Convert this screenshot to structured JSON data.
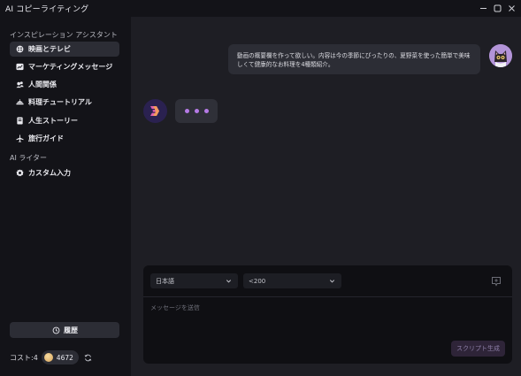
{
  "window": {
    "title": "AI コピーライティング",
    "controls": {
      "minimize": "—",
      "maximize": "□",
      "close": "✕"
    }
  },
  "sidebar": {
    "section_inspiration": "インスピレーション アシスタント",
    "items": [
      {
        "label": "映画とテレビ",
        "icon": "film-reel-icon",
        "active": true
      },
      {
        "label": "マーケティングメッセージ",
        "icon": "chart-line-icon",
        "active": false
      },
      {
        "label": "人間関係",
        "icon": "people-icon",
        "active": false
      },
      {
        "label": "料理チュートリアル",
        "icon": "cooking-pot-icon",
        "active": false
      },
      {
        "label": "人生ストーリー",
        "icon": "book-icon",
        "active": false
      },
      {
        "label": "旅行ガイド",
        "icon": "airplane-icon",
        "active": false
      }
    ],
    "section_writer": "AI ライター",
    "writer_items": [
      {
        "label": "カスタム入力",
        "icon": "gear-icon"
      }
    ],
    "history_label": "履歴",
    "cost_label": "コスト:4",
    "coin_balance": "4672"
  },
  "chat": {
    "user_message": "動画の概要欄を作って欲しい。内容は今の季節にぴったりの、夏野菜を使った簡単で美味しくて健康的なお料理を4種類紹介。",
    "bot_typing": true
  },
  "composer": {
    "language_value": "日本語",
    "length_value": "<200",
    "message_placeholder": "メッセージを送信",
    "generate_label": "スクリプト生成"
  },
  "colors": {
    "accent_purple": "#b57ae6",
    "sidebar_bg": "#131318",
    "main_bg": "#1e1e24"
  }
}
